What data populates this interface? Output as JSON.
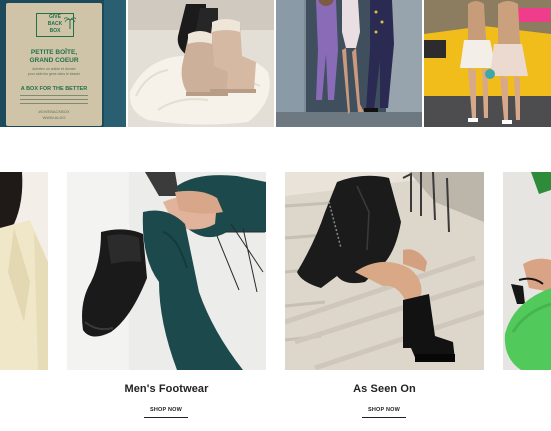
{
  "promo_card": {
    "logo": [
      "GIVE",
      "BACK",
      "BOX"
    ],
    "heading": [
      "PETITE BOÎTE,",
      "GRAND COEUR"
    ],
    "body": [
      "Achetez un article et donner",
      "pour aide les gens dans le besoin"
    ],
    "subheading": "A BOX FOR THE BETTER",
    "hashtag": "#GIVEBACKBOX",
    "handle": "WWW.ALDO"
  },
  "categories": [
    {
      "title": "Men's Footwear",
      "cta": "SHOP NOW"
    },
    {
      "title": "As Seen On",
      "cta": "SHOP NOW"
    }
  ],
  "colors": {
    "promo_green": "#22704a",
    "promo_card": "#cfc4a8",
    "text_dark": "#222222",
    "pants_teal": "#1c4a4c",
    "sneaker_green": "#52c95b"
  }
}
